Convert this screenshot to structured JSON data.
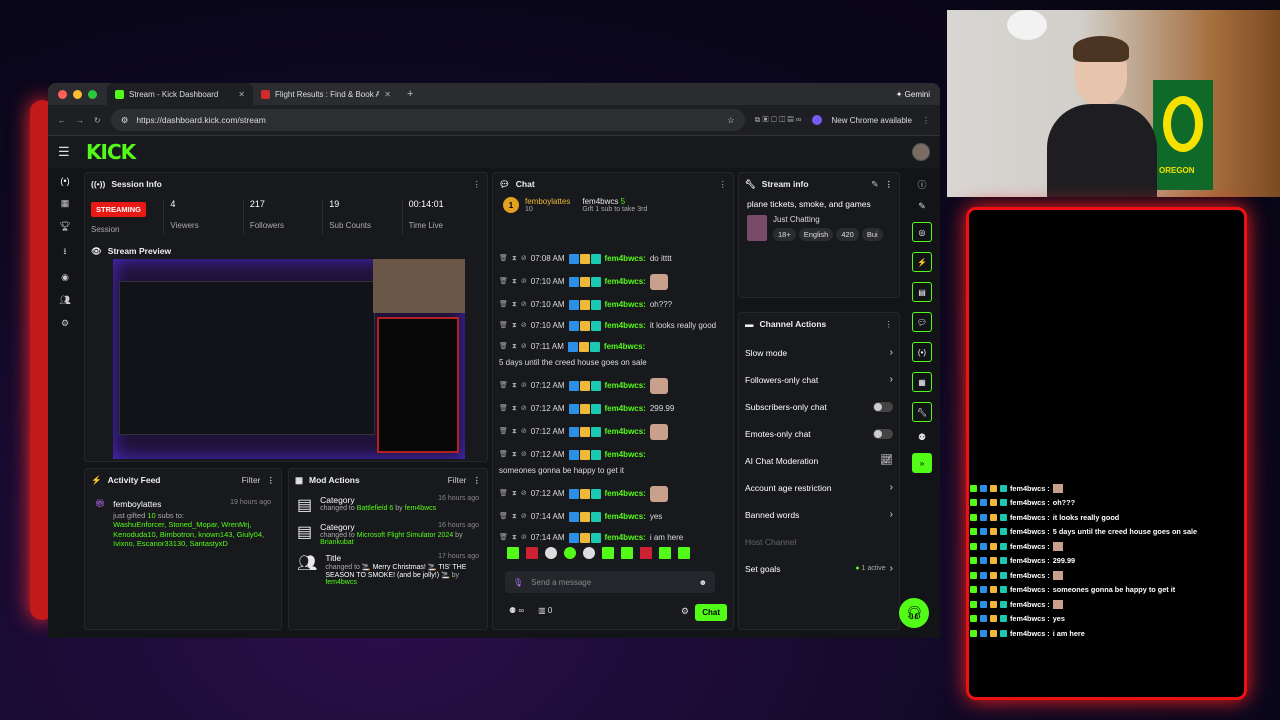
{
  "browser": {
    "tabs": [
      {
        "title": "Stream - Kick Dashboard",
        "active": true,
        "color": "#53fc18"
      },
      {
        "title": "Flight Results : Find & Book A",
        "active": false,
        "color": "#d12a2a"
      }
    ],
    "gemini_label": "✦ Gemini",
    "url": "https://dashboard.kick.com/stream",
    "update_label": "New Chrome available"
  },
  "kick": {
    "logo": "KICK",
    "session": {
      "title": "Session Info",
      "status": "STREAMING",
      "session_label": "Session",
      "stats": [
        {
          "value": "4",
          "label": "Viewers"
        },
        {
          "value": "217",
          "label": "Followers"
        },
        {
          "value": "19",
          "label": "Sub Counts"
        },
        {
          "value": "00:14:01",
          "label": "Time Live"
        }
      ]
    },
    "preview": {
      "title": "Stream Preview"
    },
    "activity": {
      "title": "Activity Feed",
      "filter": "Filter",
      "user": "femboylattes",
      "time": "19 hours ago",
      "text_pre": "just gifted",
      "count": "10",
      "text_post": "subs to:",
      "recipients": "WashuEnforcer, Stoned_Mopar, WrenMrj, Kenoduda10, Bimbotron, known143, Giuly04, Ivixno, Escanor33130, SantastyxD"
    },
    "mod": {
      "title": "Mod Actions",
      "filter": "Filter",
      "items": [
        {
          "type": "Category",
          "time": "16 hours ago",
          "pre": "changed to",
          "value": "Battlefield 6",
          "by": "by",
          "user": "fem4bwcs"
        },
        {
          "type": "Category",
          "time": "16 hours ago",
          "pre": "changed to",
          "value": "Microsoft Flight Simulator 2024",
          "by": "by",
          "user": "Briankubat"
        },
        {
          "type": "Title",
          "time": "17 hours ago",
          "pre": "changed to",
          "value": "🚬 Merry Christmas! 🚬 TIS' THE SEASON TO SMOKE! (and be jolly!) 🚬",
          "by": "by",
          "user": "fem4bwcs"
        }
      ]
    },
    "chat": {
      "title": "Chat",
      "pinned": {
        "rank": "1",
        "user": "femboylattes",
        "count": "10",
        "target": "fem4bwcs",
        "target_count": "5",
        "text": "Gift 1 sub to take 3rd"
      },
      "messages": [
        {
          "time": "07:08 AM",
          "user": "fem4bwcs:",
          "text": "do itttt",
          "emote": false
        },
        {
          "time": "07:10 AM",
          "user": "fem4bwcs:",
          "text": "",
          "emote": true
        },
        {
          "time": "07:10 AM",
          "user": "fem4bwcs:",
          "text": "oh???",
          "emote": false
        },
        {
          "time": "07:10 AM",
          "user": "fem4bwcs:",
          "text": "it looks really good",
          "emote": false
        },
        {
          "time": "07:11 AM",
          "user": "fem4bwcs:",
          "text": "5 days until the creed house goes on sale",
          "emote": false
        },
        {
          "time": "07:12 AM",
          "user": "fem4bwcs:",
          "text": "",
          "emote": true
        },
        {
          "time": "07:12 AM",
          "user": "fem4bwcs:",
          "text": "299.99",
          "emote": false
        },
        {
          "time": "07:12 AM",
          "user": "fem4bwcs:",
          "text": "",
          "emote": true
        },
        {
          "time": "07:12 AM",
          "user": "fem4bwcs:",
          "text": "someones gonna be happy to get it",
          "emote": false
        },
        {
          "time": "07:12 AM",
          "user": "fem4bwcs:",
          "text": "",
          "emote": true
        },
        {
          "time": "07:14 AM",
          "user": "fem4bwcs:",
          "text": "yes",
          "emote": false
        },
        {
          "time": "07:14 AM",
          "user": "fem4bwcs:",
          "text": "i am here",
          "emote": false
        }
      ],
      "placeholder": "Send a message",
      "counter": "0",
      "send": "Chat"
    },
    "stream_info": {
      "title": "Stream info",
      "stream_title": "plane tickets, smoke, and games",
      "category": "Just Chatting",
      "tags": [
        "18+",
        "English",
        "420",
        "Bui"
      ]
    },
    "channel_actions": {
      "title": "Channel Actions",
      "items": [
        {
          "label": "Slow mode",
          "control": "arrow"
        },
        {
          "label": "Followers-only chat",
          "control": "arrow"
        },
        {
          "label": "Subscribers-only chat",
          "control": "toggle"
        },
        {
          "label": "Emotes-only chat",
          "control": "toggle"
        },
        {
          "label": "AI Chat Moderation",
          "control": "chart"
        },
        {
          "label": "Account age restriction",
          "control": "arrow"
        },
        {
          "label": "Banned words",
          "control": "arrow"
        },
        {
          "label": "Host Channel",
          "control": "none"
        },
        {
          "label": "Set goals",
          "control": "active"
        }
      ],
      "active_label": "1 active"
    }
  },
  "overlay_chat": [
    {
      "user": "fem4bwcs :",
      "text": "",
      "emote": true
    },
    {
      "user": "fem4bwcs :",
      "text": "oh???",
      "emote": false
    },
    {
      "user": "fem4bwcs :",
      "text": "it looks really good",
      "emote": false
    },
    {
      "user": "fem4bwcs :",
      "text": "5 days until the creed house goes on sale",
      "emote": false
    },
    {
      "user": "fem4bwcs :",
      "text": "",
      "emote": true
    },
    {
      "user": "fem4bwcs :",
      "text": "299.99",
      "emote": false
    },
    {
      "user": "fem4bwcs :",
      "text": "",
      "emote": true
    },
    {
      "user": "fem4bwcs :",
      "text": "someones gonna be happy to get it",
      "emote": false
    },
    {
      "user": "fem4bwcs :",
      "text": "",
      "emote": true
    },
    {
      "user": "fem4bwcs :",
      "text": "yes",
      "emote": false
    },
    {
      "user": "fem4bwcs :",
      "text": "i am here",
      "emote": false
    }
  ],
  "webcam": {
    "poster_text": "OREGON"
  },
  "colors": {
    "accent": "#53fc18",
    "live": "#e91916",
    "overlay_border": "#ee1111"
  }
}
